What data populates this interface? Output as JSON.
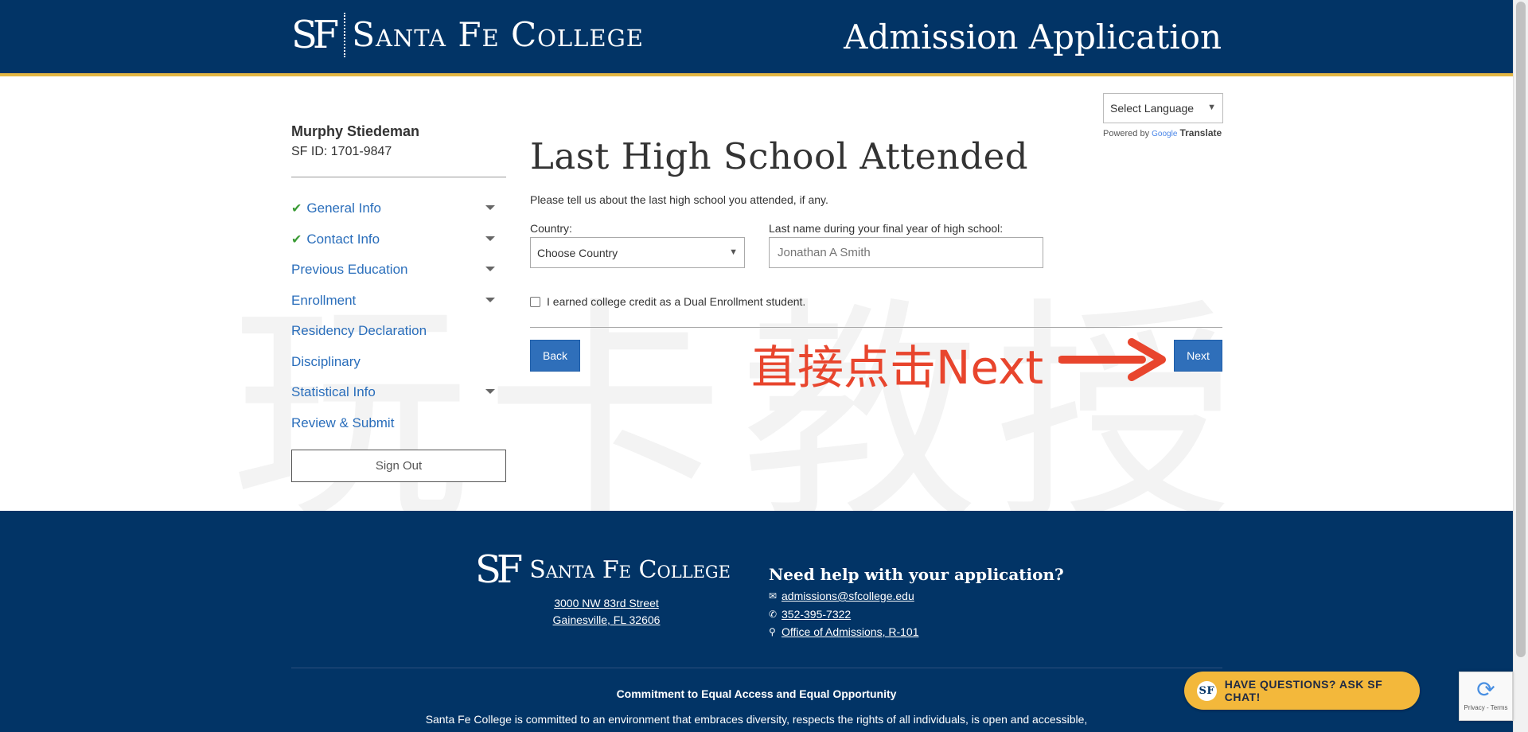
{
  "header": {
    "logo_mono": "SF",
    "logo_name": "Santa Fe College",
    "app_title": "Admission Application"
  },
  "language": {
    "select_label": "Select Language",
    "powered_by": "Powered by",
    "google": "Google",
    "translate": "Translate"
  },
  "sidebar": {
    "user_name": "Murphy Stiedeman",
    "sf_id": "SF ID: 1701-9847",
    "items": [
      {
        "label": "General Info",
        "completed": true,
        "expandable": true
      },
      {
        "label": "Contact Info",
        "completed": true,
        "expandable": true
      },
      {
        "label": "Previous Education",
        "completed": false,
        "expandable": true
      },
      {
        "label": "Enrollment",
        "completed": false,
        "expandable": true
      },
      {
        "label": "Residency Declaration",
        "completed": false,
        "expandable": false
      },
      {
        "label": "Disciplinary",
        "completed": false,
        "expandable": false
      },
      {
        "label": "Statistical Info",
        "completed": false,
        "expandable": true
      },
      {
        "label": "Review & Submit",
        "completed": false,
        "expandable": false
      }
    ],
    "sign_out": "Sign Out"
  },
  "main": {
    "title": "Last High School Attended",
    "intro": "Please tell us about the last high school you attended, if any.",
    "country_label": "Country:",
    "country_value": "Choose Country",
    "lastname_label": "Last name during your final year of high school:",
    "lastname_placeholder": "Jonathan A Smith",
    "dual_enrollment_label": "I earned college credit as a Dual Enrollment student.",
    "dual_enrollment_checked": false,
    "back_label": "Back",
    "next_label": "Next"
  },
  "overlay": {
    "watermark": "玩卡教授",
    "annotation": "直接点击Next"
  },
  "footer": {
    "logo_mono": "SF",
    "logo_name": "Santa Fe College",
    "address_line1": "3000 NW 83rd Street",
    "address_line2": "Gainesville, FL 32606",
    "help_title": "Need help with your application?",
    "email": "admissions@sfcollege.edu",
    "phone": "352-395-7322",
    "office": "Office of Admissions, R-101",
    "commitment_title": "Commitment to Equal Access and Equal Opportunity",
    "commitment_text": "Santa Fe College is committed to an environment that embraces diversity, respects the rights of all individuals, is open and accessible,"
  },
  "chat": {
    "badge": "SF",
    "label": "HAVE QUESTIONS? ASK SF CHAT!"
  },
  "recaptcha": {
    "terms": "Privacy - Terms"
  },
  "colors": {
    "navy": "#023466",
    "gold": "#e3b643",
    "link_blue": "#2a6ebb",
    "button_blue": "#2f6fba",
    "check_green": "#3a9b35",
    "annotation_red": "#e8452d",
    "chat_yellow": "#f3b83b"
  }
}
